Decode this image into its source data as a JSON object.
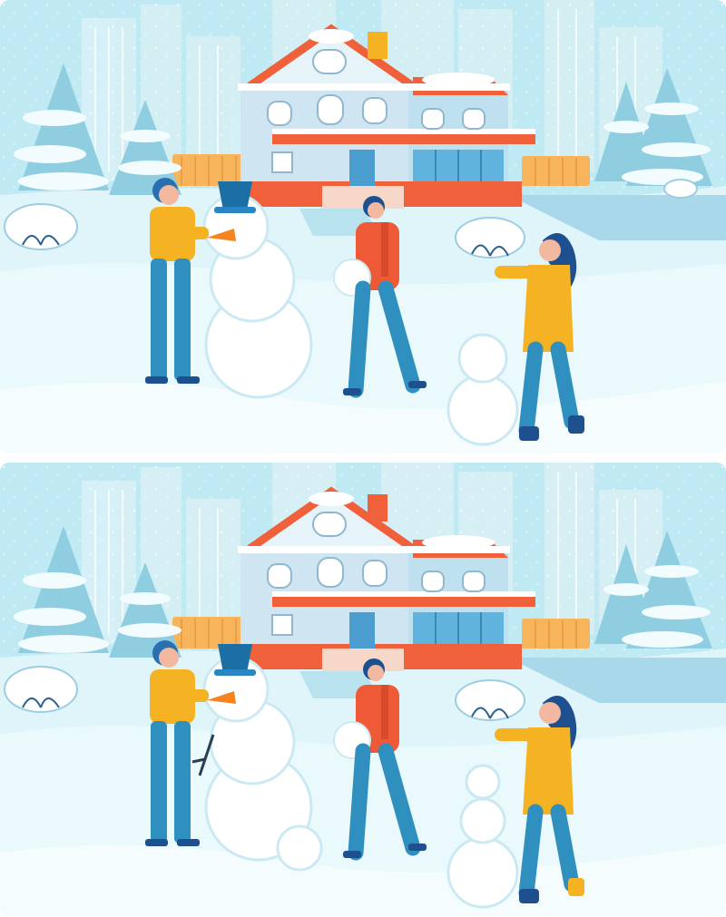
{
  "game": {
    "type": "spot-the-difference",
    "colors": {
      "sky": "#bfeaf3",
      "snow": "#f2fbfd",
      "ground": "#dff5f9",
      "buildings": "#d6f0f5",
      "roof": "#f0603a",
      "house_wall": "#cfe6f2",
      "fence": "#f7b45a",
      "tree": "#8fcde0",
      "mustard": "#f5b324",
      "red_jacket": "#ef5a36",
      "pants": "#2f8fbf",
      "skin": "#f3b8a0",
      "hair": "#1e4f8f",
      "bucket": "#1b6fa5",
      "carrot": "#f5841f"
    }
  }
}
